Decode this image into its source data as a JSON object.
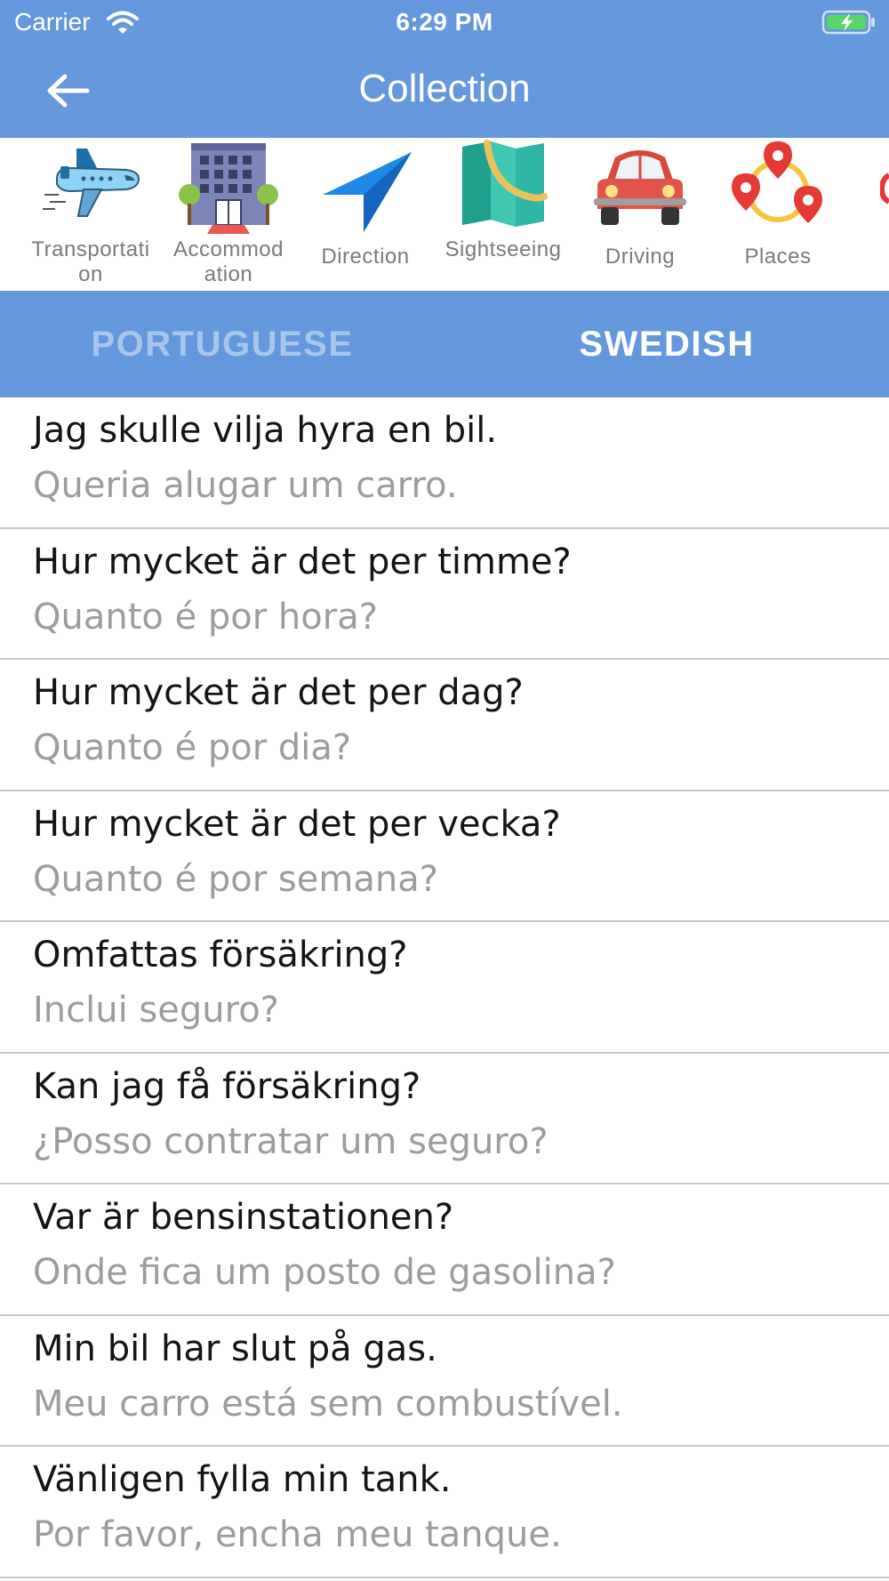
{
  "status_bar": {
    "carrier": "Carrier",
    "time": "6:29 PM"
  },
  "nav": {
    "title": "Collection"
  },
  "categories": [
    {
      "label": "Transportation",
      "icon": "airplane-icon"
    },
    {
      "label": "Accommodation",
      "icon": "hotel-building-icon"
    },
    {
      "label": "Direction",
      "icon": "direction-arrow-icon"
    },
    {
      "label": "Sightseeing",
      "icon": "map-icon"
    },
    {
      "label": "Driving",
      "icon": "car-icon"
    },
    {
      "label": "Places",
      "icon": "map-pins-icon"
    }
  ],
  "tabs": [
    {
      "label": "PORTUGUESE",
      "active": false
    },
    {
      "label": "SWEDISH",
      "active": true
    }
  ],
  "phrases": [
    {
      "sv": "Jag skulle vilja hyra en bil.",
      "pt": "Queria alugar um carro."
    },
    {
      "sv": "Hur mycket är det per timme?",
      "pt": "Quanto é por hora?"
    },
    {
      "sv": "Hur mycket är det per dag?",
      "pt": "Quanto é por dia?"
    },
    {
      "sv": "Hur mycket är det per vecka?",
      "pt": "Quanto é por semana?"
    },
    {
      "sv": "Omfattas försäkring?",
      "pt": "Inclui seguro?"
    },
    {
      "sv": "Kan jag få försäkring?",
      "pt": "¿Posso contratar um seguro?"
    },
    {
      "sv": "Var är bensinstationen?",
      "pt": "Onde fica um posto de gasolina?"
    },
    {
      "sv": "Min bil har slut på gas.",
      "pt": "Meu carro está sem combustível."
    },
    {
      "sv": "Vänligen fylla min tank.",
      "pt": "Por favor, encha meu tanque."
    }
  ],
  "colors": {
    "header_blue": "#6497DC",
    "tab_inactive": "#A8C5EC",
    "divider": "#C8C8C8",
    "secondary_text": "#9C9C9C"
  }
}
